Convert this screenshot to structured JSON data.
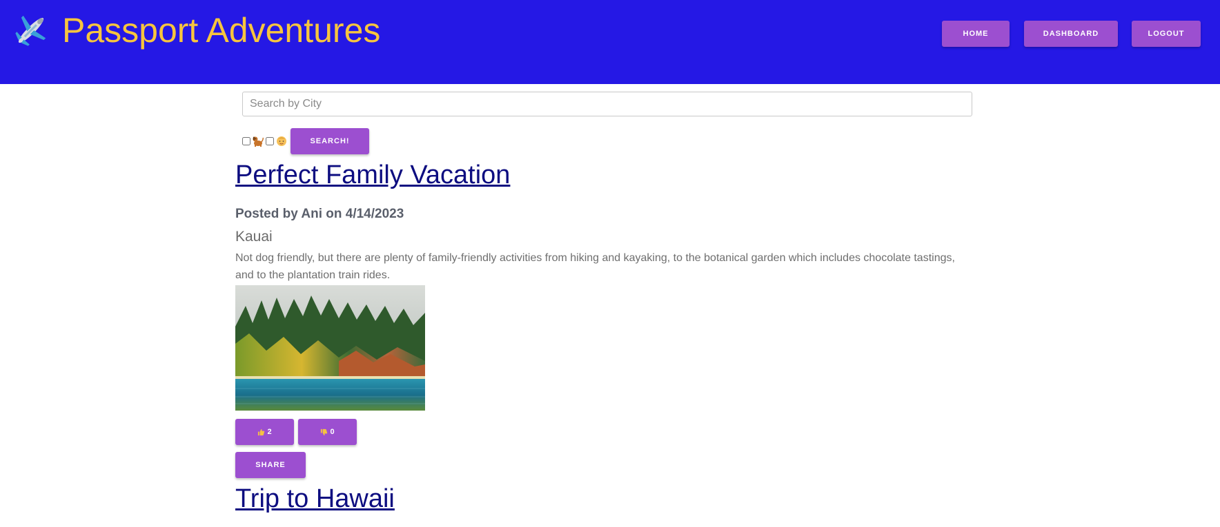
{
  "header": {
    "title": "Passport Adventures",
    "brand_icon": "airplane-icon",
    "background": "#2518e5",
    "title_color": "#f7c53e",
    "nav": [
      {
        "label": "HOME"
      },
      {
        "label": "DASHBOARD"
      },
      {
        "label": "LOGOUT"
      }
    ]
  },
  "search": {
    "placeholder": "Search by City",
    "value": "",
    "filters": [
      {
        "icon": "dog-icon",
        "checked": false
      },
      {
        "icon": "child-icon",
        "checked": false
      }
    ],
    "button_label": "SEARCH!"
  },
  "posts": [
    {
      "title": "Perfect Family Vacation",
      "meta": "Posted by Ani on 4/14/2023",
      "city": "Kauai",
      "body": "Not dog friendly, but there are plenty of family-friendly activities from hiking and kayaking, to the botanical garden which includes chocolate tastings, and to the plantation train rides.",
      "image": "coastal-cliffs-photo",
      "likes": "2",
      "dislikes": "0",
      "like_icon": "thumbs-up-icon",
      "dislike_icon": "thumbs-down-icon",
      "share_label": "SHARE"
    },
    {
      "title": "Trip to Hawaii"
    }
  ],
  "colors": {
    "button": "#9c4fd0",
    "link": "#0d0d80"
  }
}
